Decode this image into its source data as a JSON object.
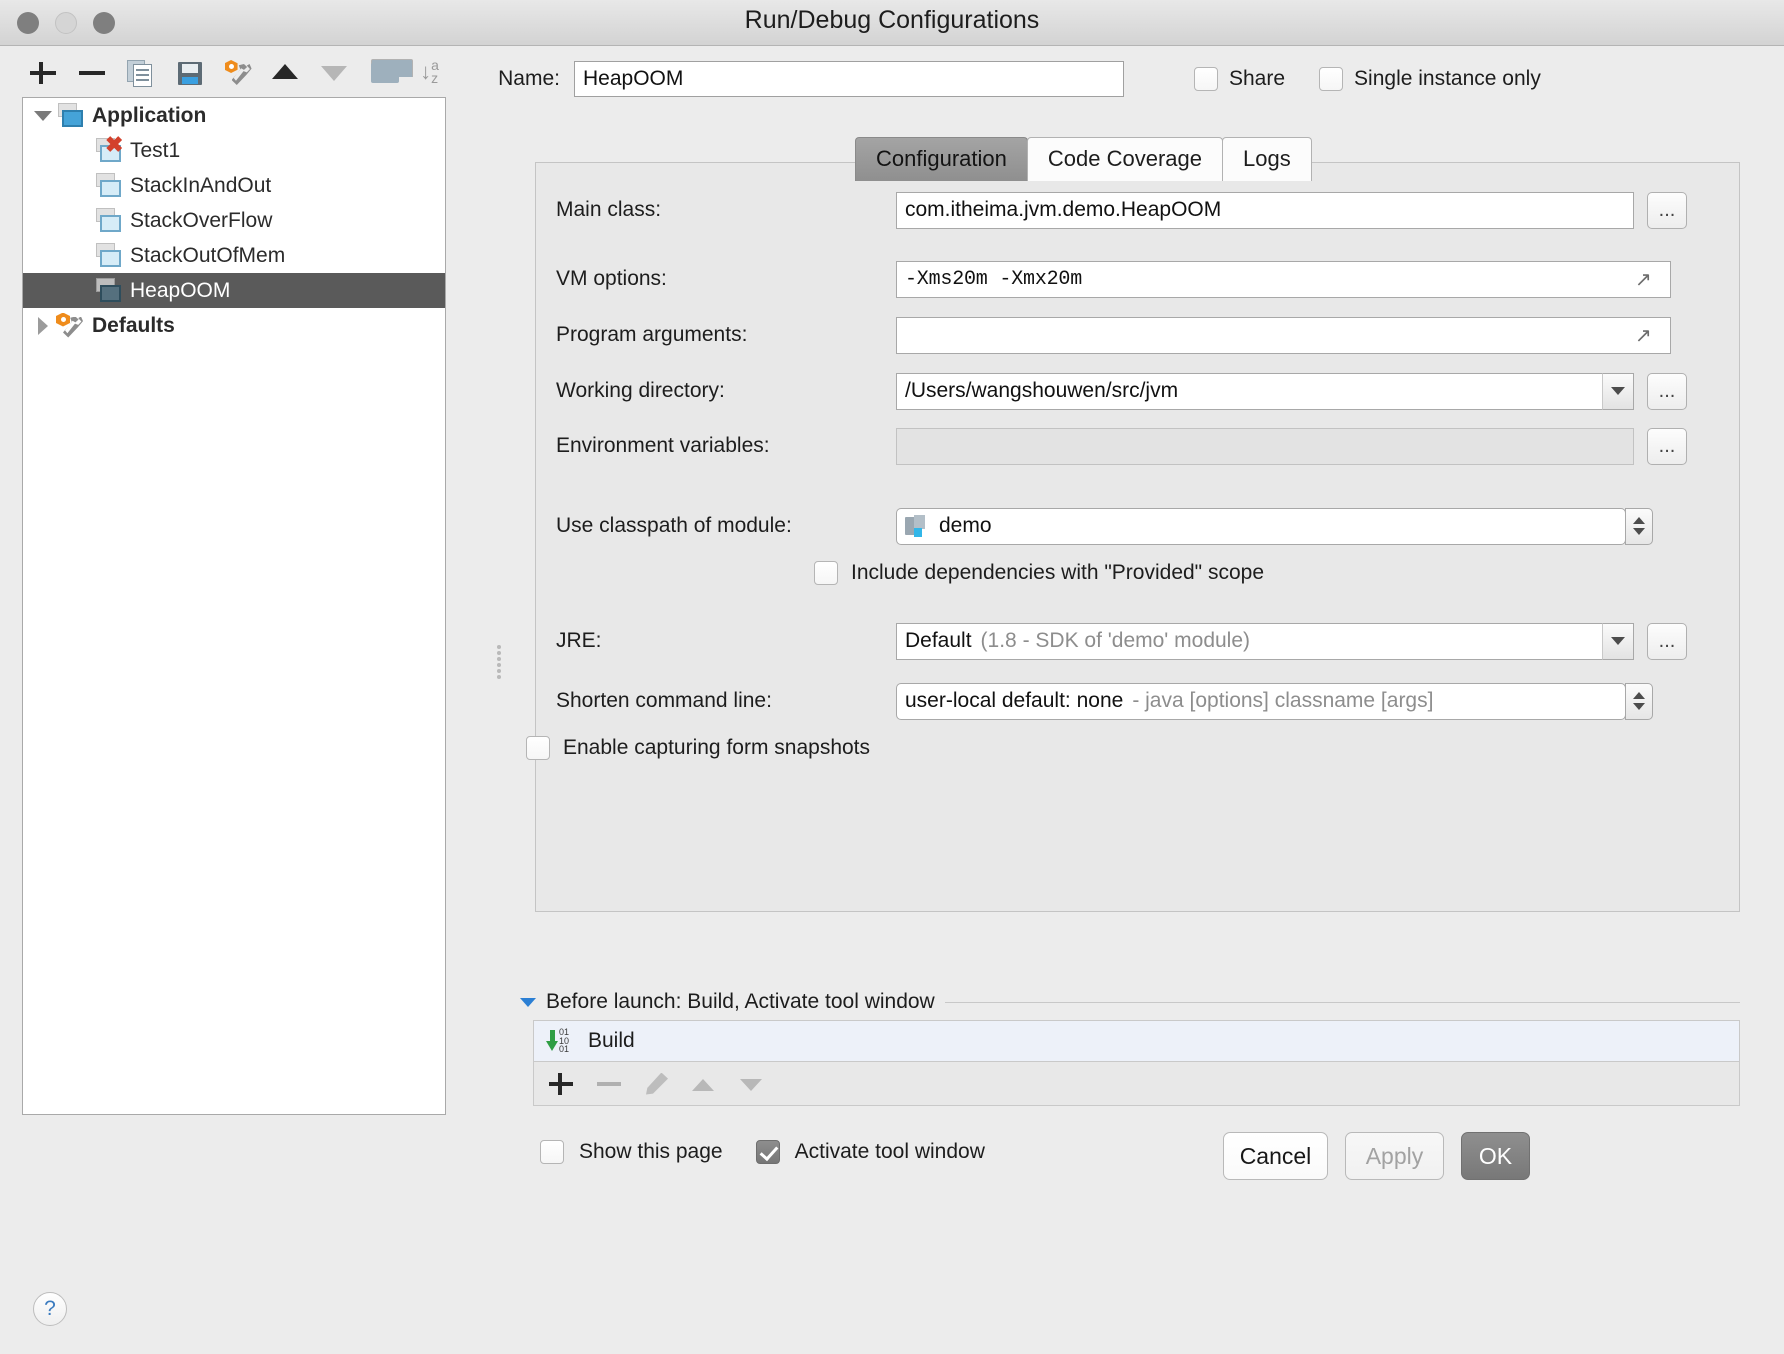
{
  "window": {
    "title": "Run/Debug Configurations",
    "traffic_lights": [
      "close",
      "minimize",
      "zoom"
    ]
  },
  "toolbar": {
    "items": [
      {
        "name": "add",
        "icon": "plus-icon"
      },
      {
        "name": "remove",
        "icon": "minus-icon"
      },
      {
        "name": "copy",
        "icon": "copy-icon"
      },
      {
        "name": "save",
        "icon": "save-icon"
      },
      {
        "name": "edit-defaults",
        "icon": "wrench-icon"
      },
      {
        "name": "move-up",
        "icon": "arrow-up-icon"
      },
      {
        "name": "move-down",
        "icon": "arrow-down-icon"
      },
      {
        "name": "new-folder",
        "icon": "folder-icon"
      },
      {
        "name": "sort",
        "icon": "sort-az-icon"
      }
    ]
  },
  "name_row": {
    "label": "Name:",
    "value": "HeapOOM",
    "share_label": "Share",
    "share_checked": false,
    "single_instance_label": "Single instance only",
    "single_instance_checked": false
  },
  "tree": {
    "nodes": [
      {
        "label": "Application",
        "bold": true,
        "expanded": true,
        "level": 0,
        "icon": "app-config-icon",
        "selected": false
      },
      {
        "label": "Test1",
        "bold": false,
        "level": 1,
        "icon": "config-error-icon",
        "selected": false
      },
      {
        "label": "StackInAndOut",
        "bold": false,
        "level": 1,
        "icon": "config-icon",
        "selected": false
      },
      {
        "label": "StackOverFlow",
        "bold": false,
        "level": 1,
        "icon": "config-icon",
        "selected": false
      },
      {
        "label": "StackOutOfMem",
        "bold": false,
        "level": 1,
        "icon": "config-icon",
        "selected": false
      },
      {
        "label": "HeapOOM",
        "bold": false,
        "level": 1,
        "icon": "config-icon",
        "selected": true
      },
      {
        "label": "Defaults",
        "bold": true,
        "expanded": false,
        "level": 0,
        "icon": "defaults-wrench-icon",
        "selected": false
      }
    ]
  },
  "tabs": [
    {
      "label": "Configuration",
      "active": true
    },
    {
      "label": "Code Coverage",
      "active": false
    },
    {
      "label": "Logs",
      "active": false
    }
  ],
  "form": {
    "main_class": {
      "label": "Main class:",
      "value": "com.itheima.jvm.demo.HeapOOM",
      "browse": "..."
    },
    "vm_options": {
      "label": "VM options:",
      "value": "-Xms20m  -Xmx20m",
      "expand_icon": "expand-icon"
    },
    "program_arguments": {
      "label": "Program arguments:",
      "value": "",
      "expand_icon": "expand-icon"
    },
    "working_directory": {
      "label": "Working directory:",
      "value": "/Users/wangshouwen/src/jvm",
      "browse": "..."
    },
    "environment_variables": {
      "label": "Environment variables:",
      "value": "",
      "browse": "..."
    },
    "use_classpath_of_module": {
      "label": "Use classpath of module:",
      "value": "demo",
      "icon": "module-icon"
    },
    "include_provided": {
      "label": "Include dependencies with \"Provided\" scope",
      "checked": false
    },
    "jre": {
      "label": "JRE:",
      "value": "Default",
      "hint": "(1.8 - SDK of 'demo' module)",
      "browse": "..."
    },
    "shorten_command_line": {
      "label": "Shorten command line:",
      "value": "user-local default: none",
      "hint": "- java [options] classname [args]"
    },
    "enable_capturing": {
      "label": "Enable capturing form snapshots",
      "checked": false
    }
  },
  "before_launch": {
    "header": "Before launch: Build, Activate tool window",
    "tasks": [
      {
        "label": "Build",
        "icon": "build-icon"
      }
    ],
    "toolbar": [
      {
        "name": "add-task",
        "icon": "plus-icon"
      },
      {
        "name": "remove-task",
        "icon": "minus-icon"
      },
      {
        "name": "edit-task",
        "icon": "pencil-icon"
      },
      {
        "name": "move-task-up",
        "icon": "arrow-up-icon"
      },
      {
        "name": "move-task-down",
        "icon": "arrow-down-icon"
      }
    ],
    "show_this_page": {
      "label": "Show this page",
      "checked": false
    },
    "activate_tool_window": {
      "label": "Activate tool window",
      "checked": true
    }
  },
  "footer": {
    "help": "?",
    "cancel": "Cancel",
    "apply": "Apply",
    "ok": "OK"
  },
  "colors": {
    "selection": "#5a5a5a",
    "accent_blue": "#2b7fd4",
    "error_red": "#d3412c",
    "build_green": "#2f9e44",
    "orange": "#ef8c1c"
  }
}
